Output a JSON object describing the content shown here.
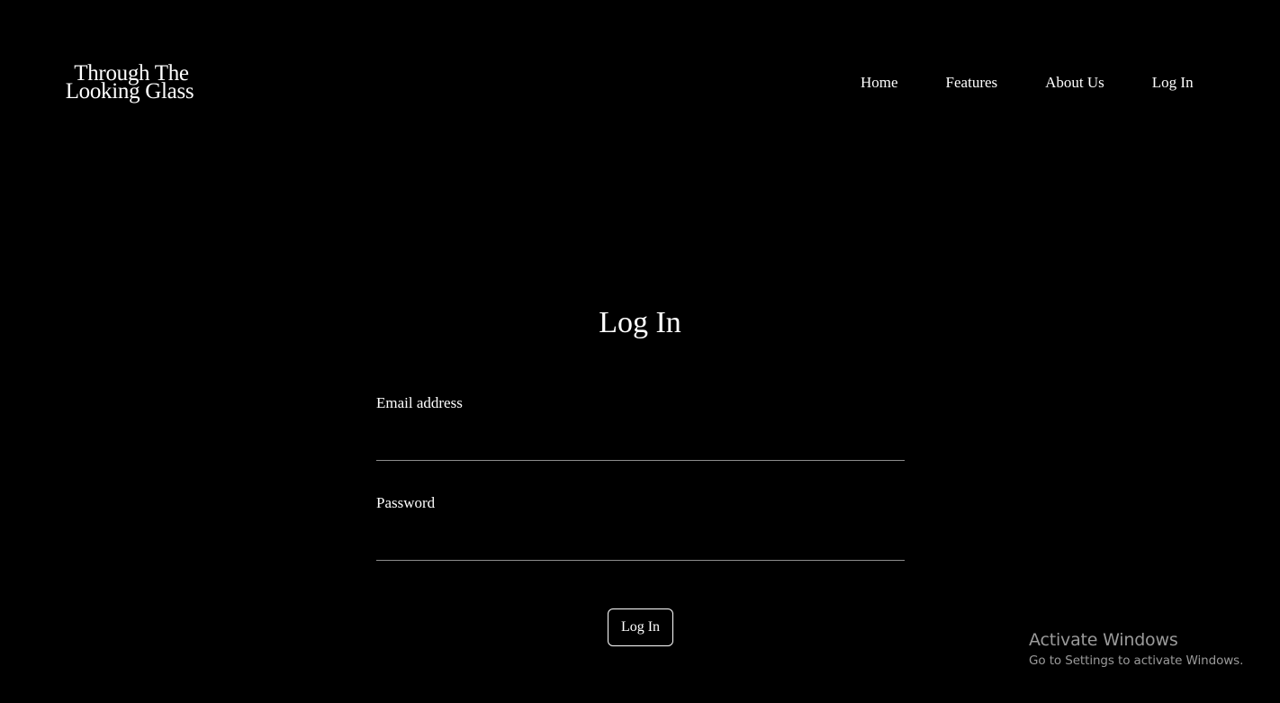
{
  "brand": {
    "line1": "Through The",
    "line2": "Looking Glass"
  },
  "nav": {
    "home": "Home",
    "features": "Features",
    "about": "About Us",
    "login": "Log In"
  },
  "main": {
    "title": "Log In",
    "email_label": "Email address",
    "email_value": "",
    "password_label": "Password",
    "password_value": "",
    "submit_label": "Log In"
  },
  "watermark": {
    "title": "Activate Windows",
    "subtitle": "Go to Settings to activate Windows."
  },
  "colors": {
    "background": "#000000",
    "text": "#ffffff",
    "field_underline": "#8c8c8c",
    "watermark": "#9a9a9a"
  }
}
